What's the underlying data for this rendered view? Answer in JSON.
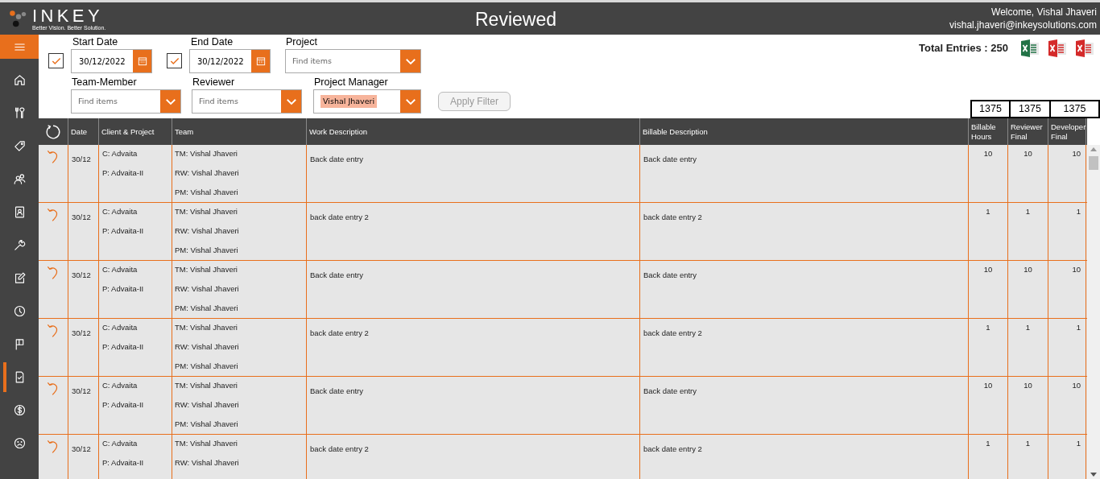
{
  "header": {
    "logo_text": "INKEY",
    "tagline": "Better Vision. Better Solution.",
    "title": "Reviewed",
    "welcome": "Welcome, Vishal Jhaveri",
    "email": "vishal.jhaveri@inkeysolutions.com"
  },
  "sidebar": {
    "items": [
      {
        "selected": false
      },
      {
        "selected": false
      },
      {
        "selected": false
      },
      {
        "selected": false
      },
      {
        "selected": false
      },
      {
        "selected": false
      },
      {
        "selected": false
      },
      {
        "selected": false
      },
      {
        "selected": false
      },
      {
        "selected": true
      },
      {
        "selected": false
      },
      {
        "selected": false
      }
    ]
  },
  "filters": {
    "start_date": {
      "label": "Start Date",
      "value": "30/12/2022",
      "checked": true
    },
    "end_date": {
      "label": "End Date",
      "value": "30/12/2022",
      "checked": true
    },
    "project": {
      "label": "Project",
      "placeholder": "Find items"
    },
    "team_member": {
      "label": "Team-Member",
      "placeholder": "Find items"
    },
    "reviewer": {
      "label": "Reviewer",
      "placeholder": "Find items"
    },
    "project_manager": {
      "label": "Project Manager",
      "tag": "Vishal Jhaveri"
    },
    "apply_button": {
      "label": "Apply Filter",
      "disabled": true
    }
  },
  "total_entries": "Total Entries : 250",
  "exports": [
    {
      "color": "#217346"
    },
    {
      "color": "#d42a2a"
    },
    {
      "color": "#d42a2a"
    }
  ],
  "totals": [
    "1375",
    "1375",
    "1375"
  ],
  "table": {
    "columns": [
      "Date",
      "Client & Project",
      "Team",
      "Work Description",
      "Billable Description",
      "Billable Hours",
      "Reviewer Final",
      "Developer Final"
    ],
    "rows": [
      {
        "date": "30/12",
        "client": "C: Advaita",
        "project": "P: Advaita-II",
        "team": [
          "TM: Vishal Jhaveri",
          "RW: Vishal Jhaveri",
          "PM: Vishal Jhaveri"
        ],
        "work": "Back date entry",
        "billable": "Back date entry",
        "hours": "10",
        "reviewer_final": "10",
        "developer_final": "10"
      },
      {
        "date": "30/12",
        "client": "C: Advaita",
        "project": "P: Advaita-II",
        "team": [
          "TM: Vishal Jhaveri",
          "RW: Vishal Jhaveri",
          "PM: Vishal Jhaveri"
        ],
        "work": "back date entry 2",
        "billable": "back date entry 2",
        "hours": "1",
        "reviewer_final": "1",
        "developer_final": "1"
      },
      {
        "date": "30/12",
        "client": "C: Advaita",
        "project": "P: Advaita-II",
        "team": [
          "TM: Vishal Jhaveri",
          "RW: Vishal Jhaveri",
          "PM: Vishal Jhaveri"
        ],
        "work": "Back date entry",
        "billable": "Back date entry",
        "hours": "10",
        "reviewer_final": "10",
        "developer_final": "10"
      },
      {
        "date": "30/12",
        "client": "C: Advaita",
        "project": "P: Advaita-II",
        "team": [
          "TM: Vishal Jhaveri",
          "RW: Vishal Jhaveri",
          "PM: Vishal Jhaveri"
        ],
        "work": "back date entry 2",
        "billable": "back date entry 2",
        "hours": "1",
        "reviewer_final": "1",
        "developer_final": "1"
      },
      {
        "date": "30/12",
        "client": "C: Advaita",
        "project": "P: Advaita-II",
        "team": [
          "TM: Vishal Jhaveri",
          "RW: Vishal Jhaveri",
          "PM: Vishal Jhaveri"
        ],
        "work": "Back date entry",
        "billable": "Back date entry",
        "hours": "10",
        "reviewer_final": "10",
        "developer_final": "10"
      },
      {
        "date": "30/12",
        "client": "C: Advaita",
        "project": "P: Advaita-II",
        "team": [
          "TM: Vishal Jhaveri",
          "RW: Vishal Jhaveri"
        ],
        "work": "back date entry 2",
        "billable": "back date entry 2",
        "hours": "1",
        "reviewer_final": "1",
        "developer_final": "1"
      }
    ]
  }
}
